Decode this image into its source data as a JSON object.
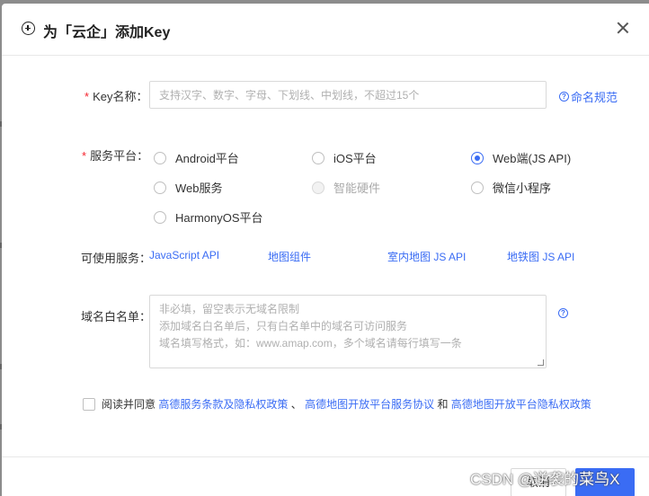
{
  "dialog": {
    "title": "为「云企」添加Key",
    "icon": "add-circle-icon",
    "close_icon": "close-icon"
  },
  "key_name": {
    "label": "Key名称：",
    "required_mark": "*",
    "placeholder": "支持汉字、数字、字母、下划线、中划线，不超过15个",
    "value": "",
    "help_label": "命名规范",
    "help_icon": "question-circle-icon"
  },
  "platform": {
    "label": "服务平台：",
    "required_mark": "*",
    "options": [
      {
        "label": "Android平台",
        "checked": false,
        "disabled": false
      },
      {
        "label": "iOS平台",
        "checked": false,
        "disabled": false
      },
      {
        "label": "Web端(JS API)",
        "checked": true,
        "disabled": false
      },
      {
        "label": "Web服务",
        "checked": false,
        "disabled": false
      },
      {
        "label": "智能硬件",
        "checked": false,
        "disabled": true
      },
      {
        "label": "微信小程序",
        "checked": false,
        "disabled": false
      },
      {
        "label": "HarmonyOS平台",
        "checked": false,
        "disabled": false
      }
    ]
  },
  "services": {
    "label": "可使用服务：",
    "items": [
      "JavaScript API",
      "地图组件",
      "室内地图 JS API",
      "地铁图 JS API"
    ]
  },
  "whitelist": {
    "label": "域名白名单：",
    "placeholder_lines": [
      "非必填，留空表示无域名限制",
      "添加域名白名单后，只有白名单中的域名可访问服务",
      "域名填写格式，如：www.amap.com，多个域名请每行填写一条"
    ],
    "help_icon": "question-circle-icon"
  },
  "agreement": {
    "checked": false,
    "prefix": "阅读并同意",
    "link1": "高德服务条款及隐私权政策",
    "sep1": "、",
    "link2": "高德地图开放平台服务协议",
    "sep2": "和",
    "link3": "高德地图开放平台隐私权政策"
  },
  "footer": {
    "cancel_label": "取消",
    "ok_label": ""
  },
  "watermark": "CSDN @逆袭的菜鸟X",
  "colors": {
    "accent": "#3a6cf4",
    "required": "#f5222d",
    "overlay": "#8c8c8c"
  }
}
